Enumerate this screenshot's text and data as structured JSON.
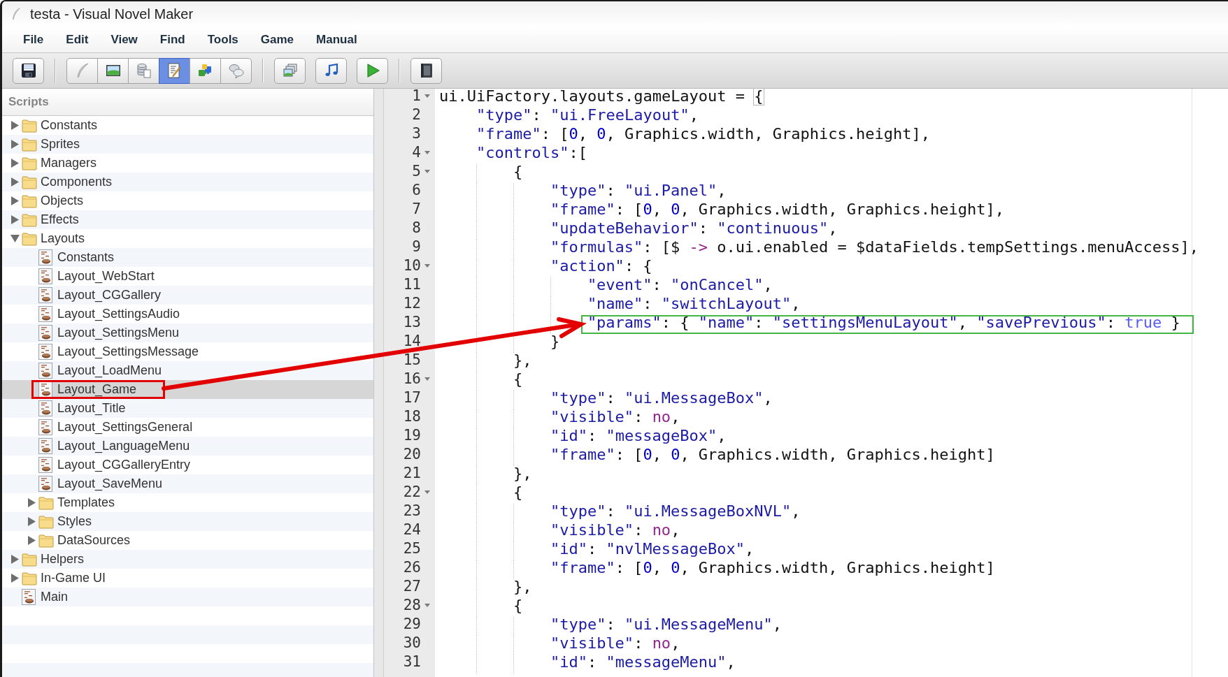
{
  "window": {
    "title": "testa - Visual Novel Maker"
  },
  "menu": [
    "File",
    "Edit",
    "View",
    "Find",
    "Tools",
    "Game",
    "Manual"
  ],
  "toolbar": {
    "groups": [
      {
        "kind": "separate",
        "buttons": [
          {
            "kind": "save",
            "selected": false
          }
        ]
      },
      {
        "kind": "segmented",
        "buttons": [
          {
            "kind": "quill",
            "selected": false
          },
          {
            "kind": "picture",
            "selected": false
          },
          {
            "kind": "database",
            "selected": false
          },
          {
            "kind": "script",
            "selected": true
          },
          {
            "kind": "puzzle",
            "selected": false
          },
          {
            "kind": "chat",
            "selected": false
          }
        ]
      },
      {
        "kind": "separate",
        "buttons": [
          {
            "kind": "layers",
            "selected": false
          },
          {
            "kind": "music",
            "selected": false
          },
          {
            "kind": "play",
            "selected": false
          }
        ]
      },
      {
        "kind": "separate",
        "buttons": [
          {
            "kind": "book",
            "selected": false
          }
        ]
      }
    ]
  },
  "sidebar": {
    "title": "Scripts",
    "tree": [
      {
        "label": "Constants",
        "kind": "folder",
        "expanded": false,
        "selected": false,
        "marked": false
      },
      {
        "label": "Sprites",
        "kind": "folder",
        "expanded": false,
        "selected": false,
        "marked": false
      },
      {
        "label": "Managers",
        "kind": "folder",
        "expanded": false,
        "selected": false,
        "marked": false
      },
      {
        "label": "Components",
        "kind": "folder",
        "expanded": false,
        "selected": false,
        "marked": false
      },
      {
        "label": "Objects",
        "kind": "folder",
        "expanded": false,
        "selected": false,
        "marked": false
      },
      {
        "label": "Effects",
        "kind": "folder",
        "expanded": false,
        "selected": false,
        "marked": false
      },
      {
        "label": "Layouts",
        "kind": "folder",
        "expanded": true,
        "selected": false,
        "marked": false,
        "children": [
          {
            "label": "Constants",
            "kind": "script",
            "selected": false,
            "marked": false
          },
          {
            "label": "Layout_WebStart",
            "kind": "script",
            "selected": false,
            "marked": false
          },
          {
            "label": "Layout_CGGallery",
            "kind": "script",
            "selected": false,
            "marked": false
          },
          {
            "label": "Layout_SettingsAudio",
            "kind": "script",
            "selected": false,
            "marked": false
          },
          {
            "label": "Layout_SettingsMenu",
            "kind": "script",
            "selected": false,
            "marked": false
          },
          {
            "label": "Layout_SettingsMessage",
            "kind": "script",
            "selected": false,
            "marked": false
          },
          {
            "label": "Layout_LoadMenu",
            "kind": "script",
            "selected": false,
            "marked": false
          },
          {
            "label": "Layout_Game",
            "kind": "script",
            "selected": true,
            "marked": true
          },
          {
            "label": "Layout_Title",
            "kind": "script",
            "selected": false,
            "marked": false
          },
          {
            "label": "Layout_SettingsGeneral",
            "kind": "script",
            "selected": false,
            "marked": false
          },
          {
            "label": "Layout_LanguageMenu",
            "kind": "script",
            "selected": false,
            "marked": false
          },
          {
            "label": "Layout_CGGalleryEntry",
            "kind": "script",
            "selected": false,
            "marked": false
          },
          {
            "label": "Layout_SaveMenu",
            "kind": "script",
            "selected": false,
            "marked": false
          },
          {
            "label": "Templates",
            "kind": "folder",
            "expanded": false,
            "selected": false,
            "marked": false
          },
          {
            "label": "Styles",
            "kind": "folder",
            "expanded": false,
            "selected": false,
            "marked": false
          },
          {
            "label": "DataSources",
            "kind": "folder",
            "expanded": false,
            "selected": false,
            "marked": false
          }
        ]
      },
      {
        "label": "Helpers",
        "kind": "folder",
        "expanded": false,
        "selected": false,
        "marked": false
      },
      {
        "label": "In-Game UI",
        "kind": "folder",
        "expanded": false,
        "selected": false,
        "marked": false
      },
      {
        "label": "Main",
        "kind": "script",
        "selected": false,
        "marked": false
      }
    ]
  },
  "editor": {
    "lines": [
      {
        "number": "1",
        "expanded": true,
        "marked": false,
        "tokens": [
          {
            "kind": "plain",
            "text": "ui.UiFactory.layouts.gameLayout = "
          },
          {
            "kind": "bracket",
            "text": "{"
          }
        ],
        "children": [
          {
            "number": "2",
            "marked": false,
            "tokens": [
              {
                "kind": "string",
                "text": "\"type\""
              },
              {
                "kind": "plain",
                "text": ": "
              },
              {
                "kind": "string",
                "text": "\"ui.FreeLayout\""
              },
              {
                "kind": "plain",
                "text": ","
              }
            ]
          },
          {
            "number": "3",
            "marked": false,
            "tokens": [
              {
                "kind": "string",
                "text": "\"frame\""
              },
              {
                "kind": "plain",
                "text": ": ["
              },
              {
                "kind": "number",
                "text": "0"
              },
              {
                "kind": "plain",
                "text": ", "
              },
              {
                "kind": "number",
                "text": "0"
              },
              {
                "kind": "plain",
                "text": ", Graphics.width, Graphics.height],"
              }
            ]
          },
          {
            "number": "4",
            "expanded": true,
            "marked": false,
            "tokens": [
              {
                "kind": "string",
                "text": "\"controls\""
              },
              {
                "kind": "plain",
                "text": ":["
              }
            ],
            "children": [
              {
                "number": "5",
                "expanded": true,
                "marked": false,
                "tokens": [
                  {
                    "kind": "plain",
                    "text": "{"
                  }
                ],
                "children": [
                  {
                    "number": "6",
                    "marked": false,
                    "tokens": [
                      {
                        "kind": "string",
                        "text": "\"type\""
                      },
                      {
                        "kind": "plain",
                        "text": ": "
                      },
                      {
                        "kind": "string",
                        "text": "\"ui.Panel\""
                      },
                      {
                        "kind": "plain",
                        "text": ","
                      }
                    ]
                  },
                  {
                    "number": "7",
                    "marked": false,
                    "tokens": [
                      {
                        "kind": "string",
                        "text": "\"frame\""
                      },
                      {
                        "kind": "plain",
                        "text": ": ["
                      },
                      {
                        "kind": "number",
                        "text": "0"
                      },
                      {
                        "kind": "plain",
                        "text": ", "
                      },
                      {
                        "kind": "number",
                        "text": "0"
                      },
                      {
                        "kind": "plain",
                        "text": ", Graphics.width, Graphics.height],"
                      }
                    ]
                  },
                  {
                    "number": "8",
                    "marked": false,
                    "tokens": [
                      {
                        "kind": "string",
                        "text": "\"updateBehavior\""
                      },
                      {
                        "kind": "plain",
                        "text": ": "
                      },
                      {
                        "kind": "string",
                        "text": "\"continuous\""
                      },
                      {
                        "kind": "plain",
                        "text": ","
                      }
                    ]
                  },
                  {
                    "number": "9",
                    "marked": false,
                    "tokens": [
                      {
                        "kind": "string",
                        "text": "\"formulas\""
                      },
                      {
                        "kind": "plain",
                        "text": ": [$ "
                      },
                      {
                        "kind": "keyword",
                        "text": "->"
                      },
                      {
                        "kind": "plain",
                        "text": " o.ui.enabled = $dataFields.tempSettings.menuAccess],"
                      }
                    ]
                  },
                  {
                    "number": "10",
                    "expanded": true,
                    "marked": false,
                    "tokens": [
                      {
                        "kind": "string",
                        "text": "\"action\""
                      },
                      {
                        "kind": "plain",
                        "text": ": {"
                      }
                    ],
                    "children": [
                      {
                        "number": "11",
                        "marked": false,
                        "tokens": [
                          {
                            "kind": "string",
                            "text": "\"event\""
                          },
                          {
                            "kind": "plain",
                            "text": ": "
                          },
                          {
                            "kind": "string",
                            "text": "\"onCancel\""
                          },
                          {
                            "kind": "plain",
                            "text": ","
                          }
                        ]
                      },
                      {
                        "number": "12",
                        "marked": false,
                        "tokens": [
                          {
                            "kind": "string",
                            "text": "\"name\""
                          },
                          {
                            "kind": "plain",
                            "text": ": "
                          },
                          {
                            "kind": "string",
                            "text": "\"switchLayout\""
                          },
                          {
                            "kind": "plain",
                            "text": ","
                          }
                        ]
                      },
                      {
                        "number": "13",
                        "marked": true,
                        "tokens": [
                          {
                            "kind": "string",
                            "text": "\"params\""
                          },
                          {
                            "kind": "plain",
                            "text": ": { "
                          },
                          {
                            "kind": "string",
                            "text": "\"name\""
                          },
                          {
                            "kind": "plain",
                            "text": ": "
                          },
                          {
                            "kind": "string",
                            "text": "\"settingsMenuLayout\""
                          },
                          {
                            "kind": "plain",
                            "text": ", "
                          },
                          {
                            "kind": "string",
                            "text": "\"savePrevious\""
                          },
                          {
                            "kind": "plain",
                            "text": ": "
                          },
                          {
                            "kind": "constant",
                            "text": "true"
                          },
                          {
                            "kind": "plain",
                            "text": " }"
                          }
                        ]
                      }
                    ]
                  },
                  {
                    "number": "14",
                    "marked": false,
                    "tokens": [
                      {
                        "kind": "plain",
                        "text": "}"
                      }
                    ]
                  }
                ]
              },
              {
                "number": "15",
                "marked": false,
                "tokens": [
                  {
                    "kind": "plain",
                    "text": "},"
                  }
                ]
              },
              {
                "number": "16",
                "expanded": true,
                "marked": false,
                "tokens": [
                  {
                    "kind": "plain",
                    "text": "{"
                  }
                ],
                "children": [
                  {
                    "number": "17",
                    "marked": false,
                    "tokens": [
                      {
                        "kind": "string",
                        "text": "\"type\""
                      },
                      {
                        "kind": "plain",
                        "text": ": "
                      },
                      {
                        "kind": "string",
                        "text": "\"ui.MessageBox\""
                      },
                      {
                        "kind": "plain",
                        "text": ","
                      }
                    ]
                  },
                  {
                    "number": "18",
                    "marked": false,
                    "tokens": [
                      {
                        "kind": "string",
                        "text": "\"visible\""
                      },
                      {
                        "kind": "plain",
                        "text": ": "
                      },
                      {
                        "kind": "keyword",
                        "text": "no"
                      },
                      {
                        "kind": "plain",
                        "text": ","
                      }
                    ]
                  },
                  {
                    "number": "19",
                    "marked": false,
                    "tokens": [
                      {
                        "kind": "string",
                        "text": "\"id\""
                      },
                      {
                        "kind": "plain",
                        "text": ": "
                      },
                      {
                        "kind": "string",
                        "text": "\"messageBox\""
                      },
                      {
                        "kind": "plain",
                        "text": ","
                      }
                    ]
                  },
                  {
                    "number": "20",
                    "marked": false,
                    "tokens": [
                      {
                        "kind": "string",
                        "text": "\"frame\""
                      },
                      {
                        "kind": "plain",
                        "text": ": ["
                      },
                      {
                        "kind": "number",
                        "text": "0"
                      },
                      {
                        "kind": "plain",
                        "text": ", "
                      },
                      {
                        "kind": "number",
                        "text": "0"
                      },
                      {
                        "kind": "plain",
                        "text": ", Graphics.width, Graphics.height]"
                      }
                    ]
                  }
                ]
              },
              {
                "number": "21",
                "marked": false,
                "tokens": [
                  {
                    "kind": "plain",
                    "text": "},"
                  }
                ]
              },
              {
                "number": "22",
                "expanded": true,
                "marked": false,
                "tokens": [
                  {
                    "kind": "plain",
                    "text": "{"
                  }
                ],
                "children": [
                  {
                    "number": "23",
                    "marked": false,
                    "tokens": [
                      {
                        "kind": "string",
                        "text": "\"type\""
                      },
                      {
                        "kind": "plain",
                        "text": ": "
                      },
                      {
                        "kind": "string",
                        "text": "\"ui.MessageBoxNVL\""
                      },
                      {
                        "kind": "plain",
                        "text": ","
                      }
                    ]
                  },
                  {
                    "number": "24",
                    "marked": false,
                    "tokens": [
                      {
                        "kind": "string",
                        "text": "\"visible\""
                      },
                      {
                        "kind": "plain",
                        "text": ": "
                      },
                      {
                        "kind": "keyword",
                        "text": "no"
                      },
                      {
                        "kind": "plain",
                        "text": ","
                      }
                    ]
                  },
                  {
                    "number": "25",
                    "marked": false,
                    "tokens": [
                      {
                        "kind": "string",
                        "text": "\"id\""
                      },
                      {
                        "kind": "plain",
                        "text": ": "
                      },
                      {
                        "kind": "string",
                        "text": "\"nvlMessageBox\""
                      },
                      {
                        "kind": "plain",
                        "text": ","
                      }
                    ]
                  },
                  {
                    "number": "26",
                    "marked": false,
                    "tokens": [
                      {
                        "kind": "string",
                        "text": "\"frame\""
                      },
                      {
                        "kind": "plain",
                        "text": ": ["
                      },
                      {
                        "kind": "number",
                        "text": "0"
                      },
                      {
                        "kind": "plain",
                        "text": ", "
                      },
                      {
                        "kind": "number",
                        "text": "0"
                      },
                      {
                        "kind": "plain",
                        "text": ", Graphics.width, Graphics.height]"
                      }
                    ]
                  }
                ]
              },
              {
                "number": "27",
                "marked": false,
                "tokens": [
                  {
                    "kind": "plain",
                    "text": "},"
                  }
                ]
              },
              {
                "number": "28",
                "expanded": true,
                "marked": false,
                "tokens": [
                  {
                    "kind": "plain",
                    "text": "{"
                  }
                ],
                "children": [
                  {
                    "number": "29",
                    "marked": false,
                    "tokens": [
                      {
                        "kind": "string",
                        "text": "\"type\""
                      },
                      {
                        "kind": "plain",
                        "text": ": "
                      },
                      {
                        "kind": "string",
                        "text": "\"ui.MessageMenu\""
                      },
                      {
                        "kind": "plain",
                        "text": ","
                      }
                    ]
                  },
                  {
                    "number": "30",
                    "marked": false,
                    "tokens": [
                      {
                        "kind": "string",
                        "text": "\"visible\""
                      },
                      {
                        "kind": "plain",
                        "text": ": "
                      },
                      {
                        "kind": "keyword",
                        "text": "no"
                      },
                      {
                        "kind": "plain",
                        "text": ","
                      }
                    ]
                  },
                  {
                    "number": "31",
                    "marked": false,
                    "tokens": [
                      {
                        "kind": "string",
                        "text": "\"id\""
                      },
                      {
                        "kind": "plain",
                        "text": ": "
                      },
                      {
                        "kind": "string",
                        "text": "\"messageMenu\""
                      },
                      {
                        "kind": "plain",
                        "text": ","
                      }
                    ]
                  }
                ]
              }
            ]
          }
        ]
      }
    ]
  },
  "callout_arrow": true
}
